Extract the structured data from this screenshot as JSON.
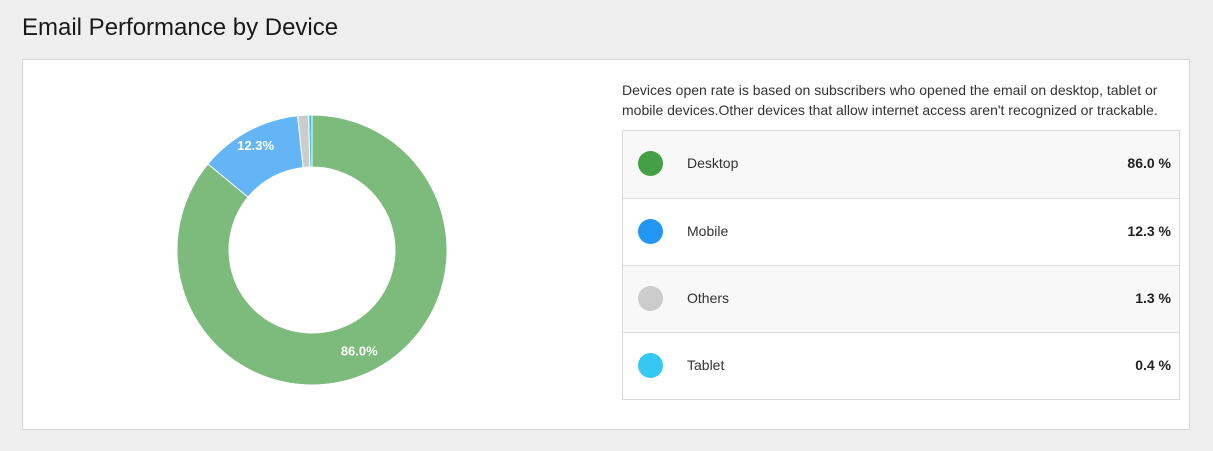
{
  "title": "Email Performance by Device",
  "description": "Devices open rate is based on subscribers who opened the email on desktop, tablet or mobile devices.Other devices that allow internet access aren't recognized or trackable.",
  "chart_data": {
    "type": "pie",
    "donut": true,
    "title": "",
    "series": [
      {
        "name": "Desktop",
        "value": 86.0,
        "display": "86.0 %",
        "slice_label": "86.0%",
        "color": "#43a047",
        "chart_color": "#7cbb7b"
      },
      {
        "name": "Mobile",
        "value": 12.3,
        "display": "12.3 %",
        "slice_label": "12.3%",
        "color": "#2196f3",
        "chart_color": "#64b5f6"
      },
      {
        "name": "Others",
        "value": 1.3,
        "display": "1.3 %",
        "slice_label": "",
        "color": "#cccccc",
        "chart_color": "#cccccc"
      },
      {
        "name": "Tablet",
        "value": 0.4,
        "display": "0.4 %",
        "slice_label": "",
        "color": "#35c8f2",
        "chart_color": "#35c8f2"
      }
    ]
  }
}
